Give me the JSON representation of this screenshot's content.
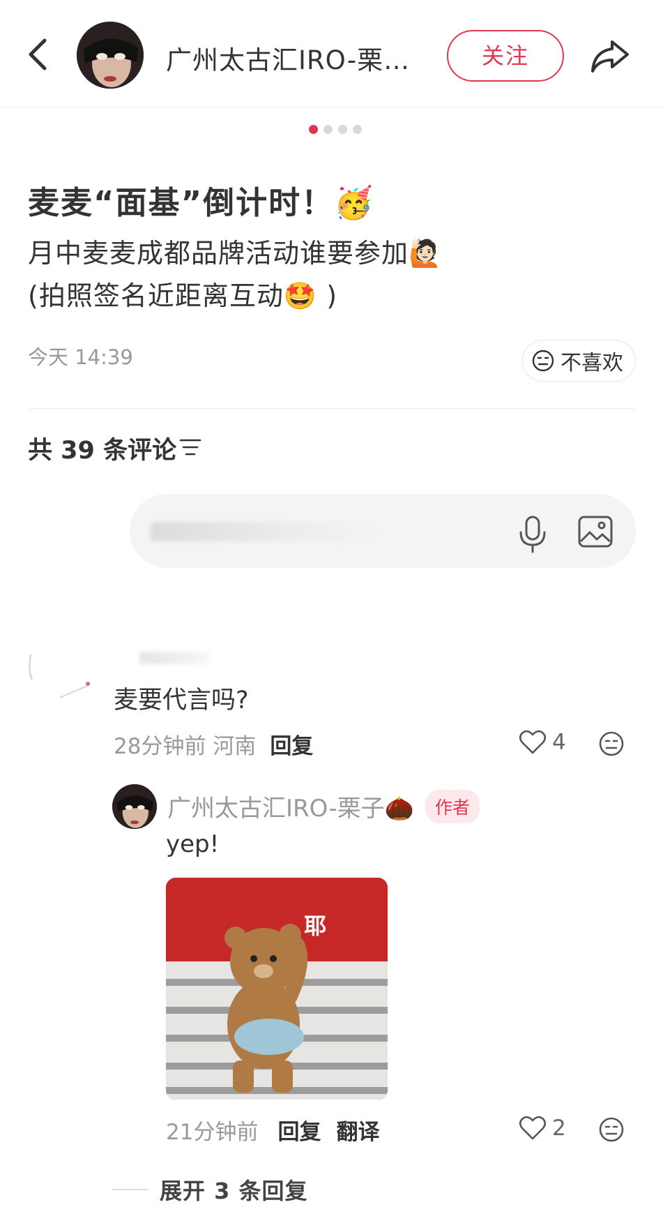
{
  "header": {
    "author_name": "广州太古汇IRO-栗子🌰",
    "follow_label": "关注",
    "back_icon": "chevron-left-icon",
    "share_icon": "share-arrow-icon"
  },
  "carousel": {
    "total": 4,
    "active": 1
  },
  "post": {
    "title": "麦麦“面基”倒计时！🥳",
    "body_line1": "月中麦麦成都品牌活动谁要参加🙋🏻",
    "body_line2": "(拍照签名近距离互动🤩 )",
    "time": "今天 14:39",
    "dislike_label": "不喜欢"
  },
  "comments": {
    "count_label": "共 39 条评论",
    "input_placeholder": "",
    "items": [
      {
        "text": "麦要代言吗?",
        "time_location": "28分钟前 河南",
        "reply_label": "回复",
        "likes": "4",
        "replies": [
          {
            "author": "广州太古汇IRO-栗子🌰",
            "badge": "作者",
            "text": "yep!",
            "sticker_caption": "耶",
            "time": "21分钟前",
            "reply_label": "回复",
            "translate_label": "翻译",
            "likes": "2"
          }
        ],
        "expand_label": "展开 3 条回复"
      }
    ]
  },
  "colors": {
    "accent": "#e0374f",
    "muted": "#999999"
  }
}
